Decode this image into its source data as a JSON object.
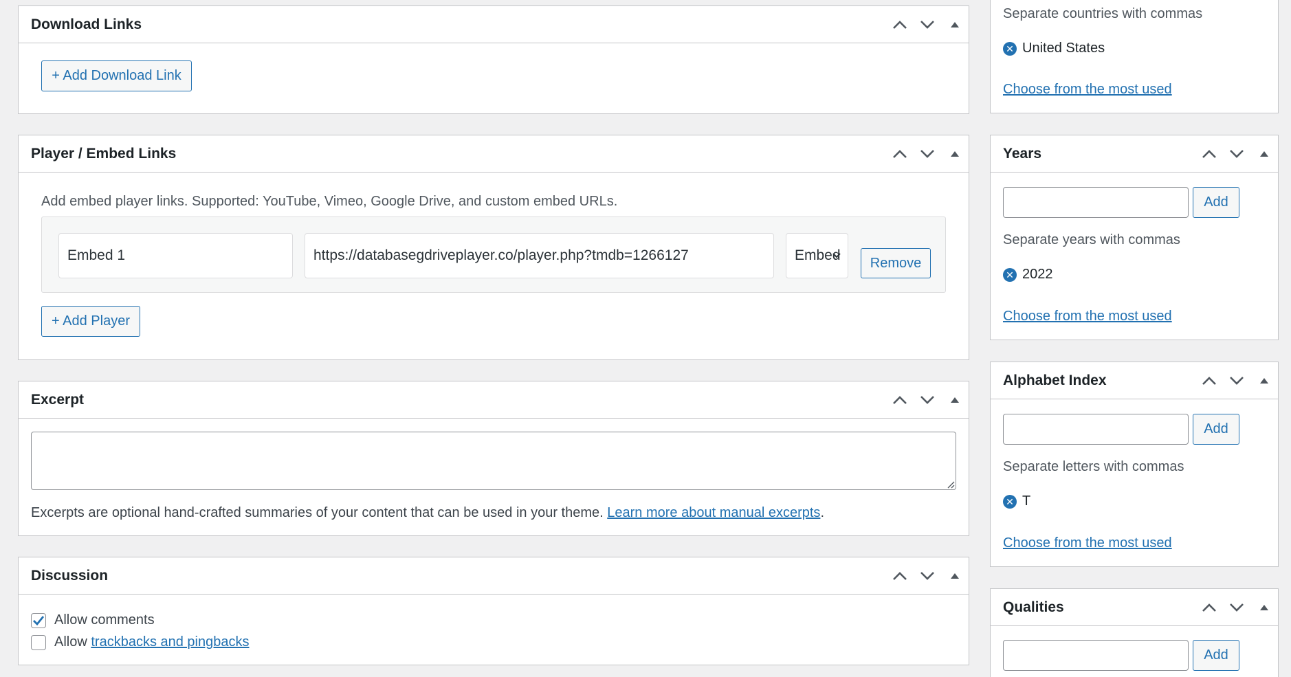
{
  "main": {
    "download": {
      "title": "Download Links",
      "add_button": "+ Add Download Link"
    },
    "player": {
      "title": "Player / Embed Links",
      "description": "Add embed player links. Supported: YouTube, Vimeo, Google Drive, and custom embed URLs.",
      "rows": [
        {
          "name": "Embed 1",
          "url": "https://databasegdriveplayer.co/player.php?tmdb=1266127",
          "type": "Embed",
          "remove_label": "Remove"
        }
      ],
      "add_button": "+ Add Player"
    },
    "excerpt": {
      "title": "Excerpt",
      "value": "",
      "help_text": "Excerpts are optional hand-crafted summaries of your content that can be used in your theme.",
      "help_link": "Learn more about manual excerpts",
      "help_end": "."
    },
    "discussion": {
      "title": "Discussion",
      "allow_comments": {
        "label": "Allow comments",
        "checked": true
      },
      "allow_trackbacks": {
        "prefix": "Allow ",
        "link": "trackbacks and pingbacks",
        "checked": false
      }
    }
  },
  "sidebar": {
    "countries": {
      "hint": "Separate countries with commas",
      "tags": [
        "United States"
      ],
      "most_used": "Choose from the most used"
    },
    "years": {
      "title": "Years",
      "add_label": "Add",
      "hint": "Separate years with commas",
      "tags": [
        "2022"
      ],
      "most_used": "Choose from the most used"
    },
    "alphabet": {
      "title": "Alphabet Index",
      "add_label": "Add",
      "hint": "Separate letters with commas",
      "tags": [
        "T"
      ],
      "most_used": "Choose from the most used"
    },
    "qualities": {
      "title": "Qualities",
      "add_label": "Add"
    }
  },
  "colors": {
    "accent": "#2271b1",
    "border": "#c3c4c7",
    "background": "#f0f0f1"
  }
}
